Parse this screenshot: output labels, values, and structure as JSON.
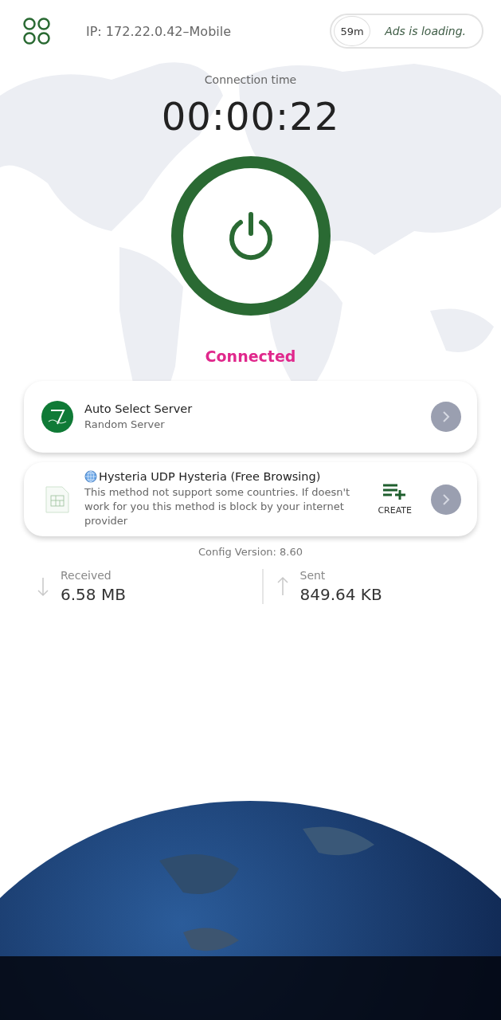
{
  "header": {
    "ip": "IP: 172.22.0.42–Mobile",
    "timer_badge": "59m",
    "ads_status": "Ads is loading."
  },
  "connection": {
    "label": "Connection time",
    "time": "00:00:22",
    "status": "Connected",
    "connected": true
  },
  "servers": [
    {
      "kind": "auto",
      "title": "Auto Select Server",
      "subtitle": "Random Server"
    },
    {
      "kind": "method",
      "title": "Hysteria UDP Hysteria (Free Browsing)",
      "subtitle": "This method not support some countries. If doesn't work for you this method is block by your internet provider",
      "action": "CREATE"
    }
  ],
  "config_version": "Config Version: 8.60",
  "stats": [
    {
      "kind": "down",
      "label": "Received",
      "value": "6.58 MB"
    },
    {
      "kind": "up",
      "label": "Sent",
      "value": "849.64 KB"
    }
  ]
}
